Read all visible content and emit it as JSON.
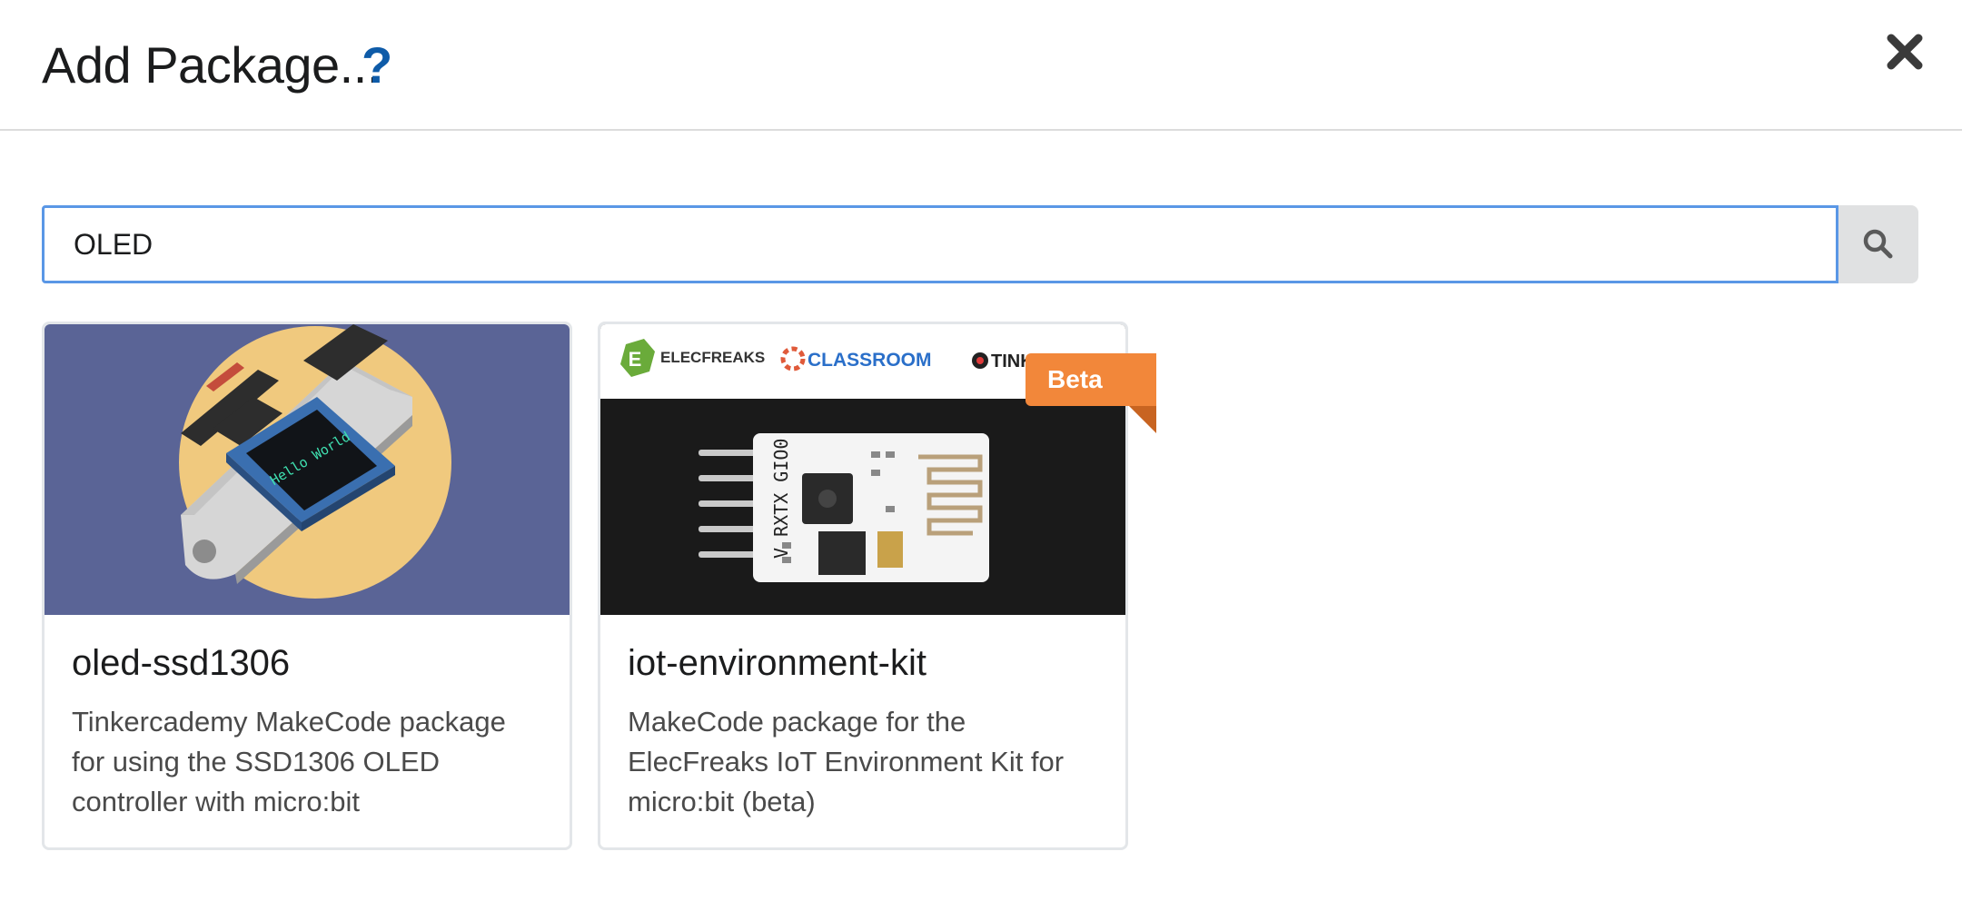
{
  "dialog": {
    "title": "Add Package...",
    "help_label": "?",
    "close_icon": "close-icon"
  },
  "search": {
    "value": "OLED",
    "button_icon": "search-icon"
  },
  "packages": [
    {
      "name": "oled-ssd1306",
      "description": "Tinkercademy MakeCode package for using the SSD1306 OLED controller with micro:bit",
      "image_text": "Hello World"
    },
    {
      "name": "iot-environment-kit",
      "description": "MakeCode package for the ElecFreaks IoT Environment Kit for micro:bit (beta)",
      "badge": "Beta",
      "image_logos": [
        "ELECFREAKS",
        "CLASSROOM",
        "TINK"
      ],
      "image_silkscreen": "V RXTX GIO0"
    }
  ],
  "colors": {
    "accent": "#0e5ba8",
    "search_border": "#5a97e6",
    "badge": "#f2873a",
    "card1_bg": "#5a6496",
    "card1_circle": "#f0c97e"
  }
}
